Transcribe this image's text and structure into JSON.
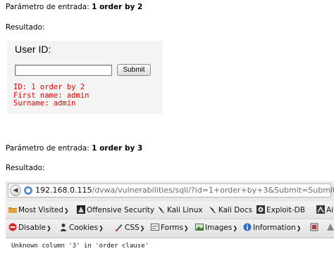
{
  "block1": {
    "param_label": "Parámetro de entrada:",
    "param_value": "1 order by 2",
    "result_label": "Resultado:"
  },
  "dvwa": {
    "title": "User ID:",
    "input_value": "",
    "submit_label": "Submit",
    "result_lines": [
      "ID: 1 order by 2",
      "First name: admin",
      "Surname: admin"
    ],
    "result_color": "#e00000"
  },
  "block2": {
    "param_label": "Parámetro de entrada:",
    "param_value": "1 order by 3",
    "result_label": "Resultado:"
  },
  "browser": {
    "url_host": "192.168.0.115",
    "url_path": "/dvwa/vulnerabilities/sqli/?id=1+order+by+3&Submit=Submit#",
    "bookmarks": [
      {
        "label": "Most Visited",
        "icon": "folder-icon",
        "dropdown": true
      },
      {
        "label": "Offensive Security",
        "icon": "offsec-icon",
        "dropdown": false
      },
      {
        "label": "Kali Linux",
        "icon": "kali-dragon-icon",
        "dropdown": false
      },
      {
        "label": "Kali Docs",
        "icon": "kali-dragon-icon",
        "dropdown": false
      },
      {
        "label": "Exploit-DB",
        "icon": "exploitdb-icon",
        "dropdown": false
      },
      {
        "label": "Ai",
        "icon": "aircrack-icon",
        "dropdown": false
      }
    ],
    "devtools": [
      {
        "label": "Disable",
        "icon": "disable-icon"
      },
      {
        "label": "Cookies",
        "icon": "cookies-icon"
      },
      {
        "label": "CSS",
        "icon": "css-icon"
      },
      {
        "label": "Forms",
        "icon": "forms-icon"
      },
      {
        "label": "Images",
        "icon": "images-icon"
      },
      {
        "label": "Information",
        "icon": "information-icon"
      }
    ],
    "page_error": "Unknown column '3' in 'order clause'"
  }
}
